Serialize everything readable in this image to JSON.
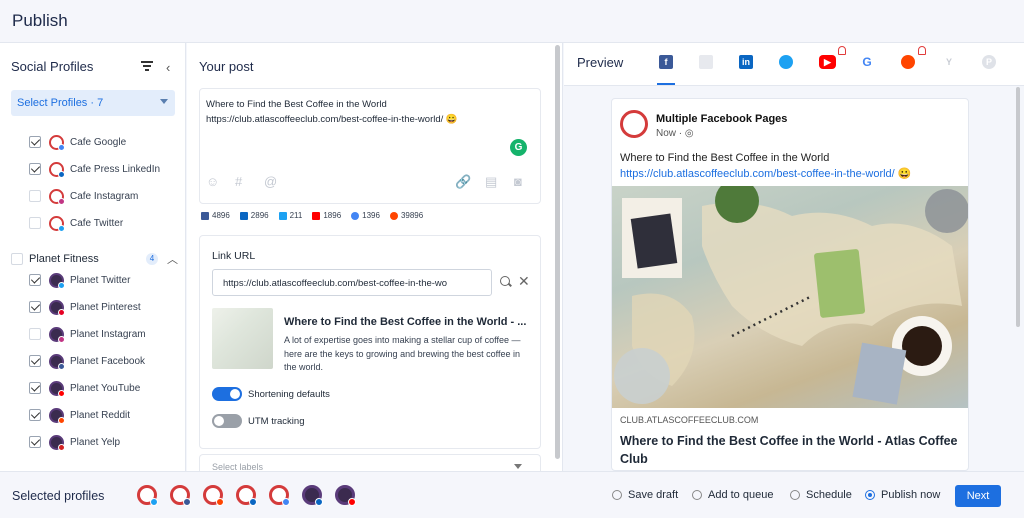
{
  "header": {
    "title": "Publish"
  },
  "sidebar": {
    "title": "Social Profiles",
    "select": "Select Profiles · 7",
    "profiles": [
      {
        "label": "Cafe Google",
        "checked": true,
        "network": "google"
      },
      {
        "label": "Cafe Press LinkedIn",
        "checked": true,
        "network": "linkedin"
      },
      {
        "label": "Cafe Instagram",
        "checked": false,
        "network": "instagram"
      },
      {
        "label": "Cafe Twitter",
        "checked": false,
        "network": "twitter"
      }
    ],
    "group": {
      "label": "Planet Fitness",
      "count": "4"
    },
    "group_profiles": [
      {
        "label": "Planet Twitter",
        "checked": true,
        "network": "twitter"
      },
      {
        "label": "Planet Pinterest",
        "checked": true,
        "network": "pinterest"
      },
      {
        "label": "Planet Instagram",
        "checked": false,
        "network": "instagram"
      },
      {
        "label": "Planet Facebook",
        "checked": true,
        "network": "facebook"
      },
      {
        "label": "Planet YouTube",
        "checked": true,
        "network": "youtube"
      },
      {
        "label": "Planet Reddit",
        "checked": true,
        "network": "reddit"
      },
      {
        "label": "Planet Yelp",
        "checked": true,
        "network": "yelp"
      }
    ]
  },
  "post": {
    "title": "Your post",
    "line1": "Where to Find the Best Coffee in the World",
    "line2": "https://club.atlascoffeeclub.com/best-coffee-in-the-world/ 😀",
    "grammarly": "G",
    "stats": [
      {
        "network": "facebook",
        "color": "#3b5998",
        "value": "4896"
      },
      {
        "network": "linkedin",
        "color": "#0a66c2",
        "value": "2896"
      },
      {
        "network": "twitter",
        "color": "#1da1f2",
        "value": "211"
      },
      {
        "network": "youtube",
        "color": "#ff0000",
        "value": "1896"
      },
      {
        "network": "google",
        "color": "#4285f4",
        "value": "1396"
      },
      {
        "network": "reddit",
        "color": "#ff4500",
        "value": "39896"
      }
    ]
  },
  "link": {
    "label": "Link URL",
    "url": "https://club.atlascoffeeclub.com/best-coffee-in-the-wo",
    "preview_title": "Where to Find the Best Coffee in the World - ...",
    "preview_desc": "A lot of expertise goes into making a stellar cup of coffee — here are the keys to growing and brewing the best coffee in the world.",
    "shortening": "Shortening defaults",
    "utm": "UTM tracking",
    "labels_placeholder": "Select labels"
  },
  "preview": {
    "title": "Preview",
    "page_name": "Multiple Facebook Pages",
    "time": "Now · ◎",
    "text": "Where to Find the Best Coffee in the World",
    "link": "https://club.atlascoffeeclub.com/best-coffee-in-the-world/ 😀",
    "domain": "CLUB.ATLASCOFFEECLUB.COM",
    "headline": "Where to Find the Best Coffee in the World - Atlas Coffee Club"
  },
  "footer": {
    "selected_label": "Selected profiles",
    "options": [
      "Save draft",
      "Add to queue",
      "Schedule",
      "Publish now"
    ],
    "selected_option": "Publish now",
    "next": "Next"
  },
  "colors": {
    "accent": "#1d6fe0",
    "bg": "#f4f6fb"
  }
}
